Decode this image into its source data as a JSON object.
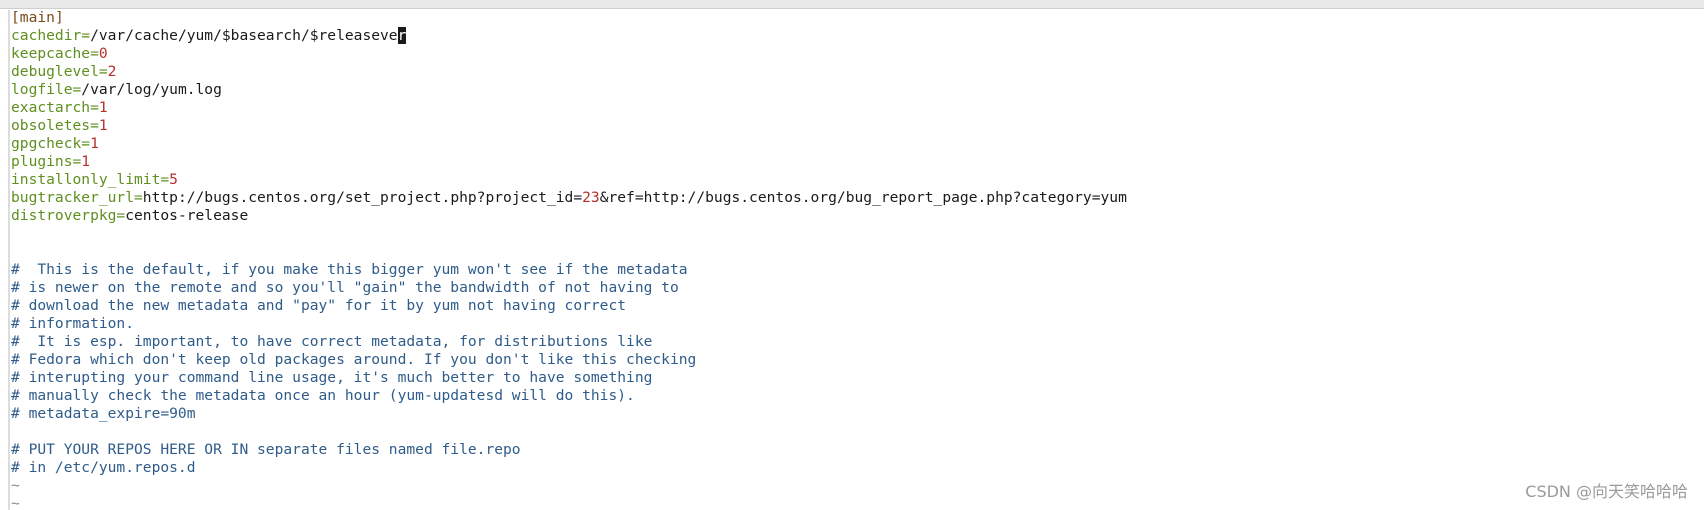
{
  "config": {
    "section_open": "[",
    "section_name": "main",
    "section_close": "]",
    "cachedir_key": "cachedir=",
    "cachedir_val": "/var/cache/yum/$basearch/$releaseve",
    "cachedir_cursor": "r",
    "keepcache_key": "keepcache=",
    "keepcache_val": "0",
    "debuglevel_key": "debuglevel=",
    "debuglevel_val": "2",
    "logfile_key": "logfile=",
    "logfile_val": "/var/log/yum.log",
    "exactarch_key": "exactarch=",
    "exactarch_val": "1",
    "obsoletes_key": "obsoletes=",
    "obsoletes_val": "1",
    "gpgcheck_key": "gpgcheck=",
    "gpgcheck_val": "1",
    "plugins_key": "plugins=",
    "plugins_val": "1",
    "installonly_key": "installonly_limit=",
    "installonly_val": "5",
    "bugtracker_key": "bugtracker_url=",
    "bugtracker_val_a": "http://bugs.centos.org/set_project.php?project_id=",
    "bugtracker_num": "23",
    "bugtracker_val_b": "&ref=http://bugs.centos.org/bug_report_page.php?category=yum",
    "distroverpkg_key": "distroverpkg=",
    "distroverpkg_val": "centos-release"
  },
  "comments": [
    "#  This is the default, if you make this bigger yum won't see if the metadata",
    "# is newer on the remote and so you'll \"gain\" the bandwidth of not having to",
    "# download the new metadata and \"pay\" for it by yum not having correct",
    "# information.",
    "#  It is esp. important, to have correct metadata, for distributions like",
    "# Fedora which don't keep old packages around. If you don't like this checking",
    "# interupting your command line usage, it's much better to have something",
    "# manually check the metadata once an hour (yum-updatesd will do this).",
    "# metadata_expire=90m",
    "# PUT YOUR REPOS HERE OR IN separate files named file.repo",
    "# in /etc/yum.repos.d"
  ],
  "tilde": "~",
  "watermark": "CSDN @向天笑哈哈哈"
}
